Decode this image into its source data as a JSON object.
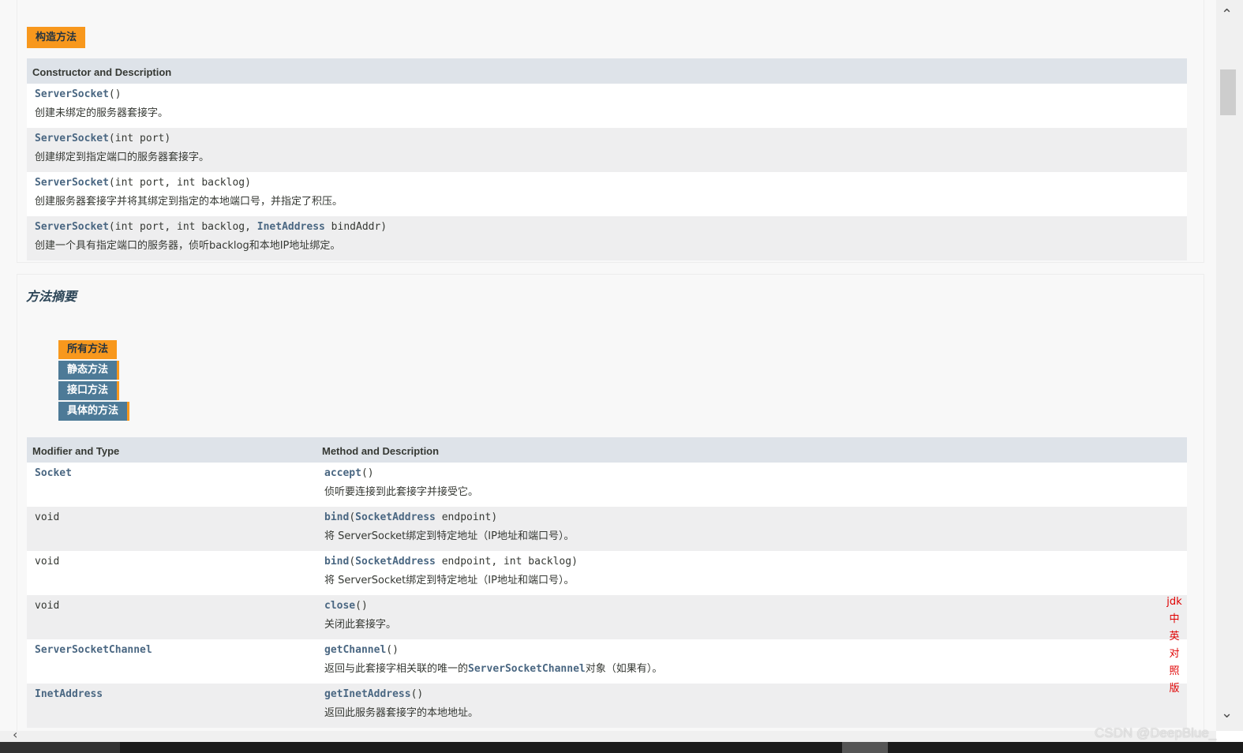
{
  "constructor_summary": {
    "caption": "构造方法",
    "header": "Constructor and Description",
    "rows": [
      {
        "name": "ServerSocket",
        "params": "()",
        "desc": "创建未绑定的服务器套接字。"
      },
      {
        "name": "ServerSocket",
        "params": "(int port)",
        "desc": "创建绑定到指定端口的服务器套接字。"
      },
      {
        "name": "ServerSocket",
        "params": "(int port, int backlog)",
        "desc": "创建服务器套接字并将其绑定到指定的本地端口号，并指定了积压。"
      },
      {
        "name": "ServerSocket",
        "params_a": "(int port, int backlog, ",
        "params_link": "InetAddress",
        "params_b": " bindAddr)",
        "desc": "创建一个具有指定端口的服务器，侦听backlog和本地IP地址绑定。"
      }
    ]
  },
  "method_summary": {
    "title": "方法摘要",
    "tabs": [
      "所有方法",
      "静态方法",
      "接口方法",
      "具体的方法"
    ],
    "header_type": "Modifier and Type",
    "header_method": "Method and Description",
    "rows": [
      {
        "type": "Socket",
        "type_link": true,
        "method": "accept",
        "params": "()",
        "desc": "侦听要连接到此套接字并接受它。"
      },
      {
        "type": "void",
        "type_link": false,
        "method": "bind",
        "params_a": "(",
        "params_link": "SocketAddress",
        "params_b": " endpoint)",
        "desc": "将 ServerSocket绑定到特定地址（IP地址和端口号）。"
      },
      {
        "type": "void",
        "type_link": false,
        "method": "bind",
        "params_a": "(",
        "params_link": "SocketAddress",
        "params_b": " endpoint, int backlog)",
        "desc": "将 ServerSocket绑定到特定地址（IP地址和端口号）。"
      },
      {
        "type": "void",
        "type_link": false,
        "method": "close",
        "params": "()",
        "desc": "关闭此套接字。"
      },
      {
        "type": "ServerSocketChannel",
        "type_link": true,
        "method": "getChannel",
        "params": "()",
        "desc_a": "返回与此套接字相关联的唯一的",
        "desc_link": "ServerSocketChannel",
        "desc_b": "对象（如果有）。"
      },
      {
        "type": "InetAddress",
        "type_link": true,
        "method": "getInetAddress",
        "params": "()",
        "desc": "返回此服务器套接字的本地地址。"
      }
    ]
  },
  "side_link": [
    "jdk",
    "中",
    "英",
    "对",
    "照",
    "版"
  ],
  "watermark": "CSDN @DeepBlue_"
}
